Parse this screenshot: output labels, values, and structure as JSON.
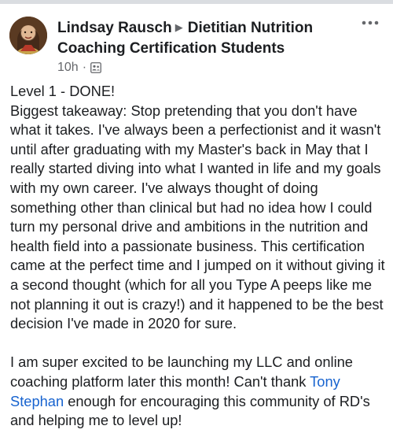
{
  "post": {
    "author": "Lindsay Rausch",
    "group": "Dietitian Nutrition Coaching Certification Students",
    "time": "10h",
    "separator": "·",
    "privacy_icon": "group-audience-icon",
    "more_icon": "more-options-icon",
    "body": {
      "p1": "Level 1 - DONE!\nBiggest takeaway: Stop pretending that you don't have what it takes. I've always been a perfectionist and it wasn't until after graduating with my Master's back in May that I really started diving into what I wanted in life and my goals with my own career. I've always thought of doing something other than clinical but had no idea how I could turn my personal drive and ambitions in the nutrition and health field into a passionate business. This certification came at the perfect time and I jumped on it without giving it a second thought (which for all you Type A peeps like me not planning it out is crazy!) and it happened to be the best decision I've made in 2020 for sure.\n\nI am super excited to be launching my LLC and online coaching platform later this month! Can't thank ",
      "mention": "Tony Stephan",
      "p2": " enough for encouraging this community of RD's and helping me to level up!"
    },
    "colors": {
      "text": "#1c1e21",
      "secondary": "#65676b",
      "link": "#1763cf"
    }
  }
}
